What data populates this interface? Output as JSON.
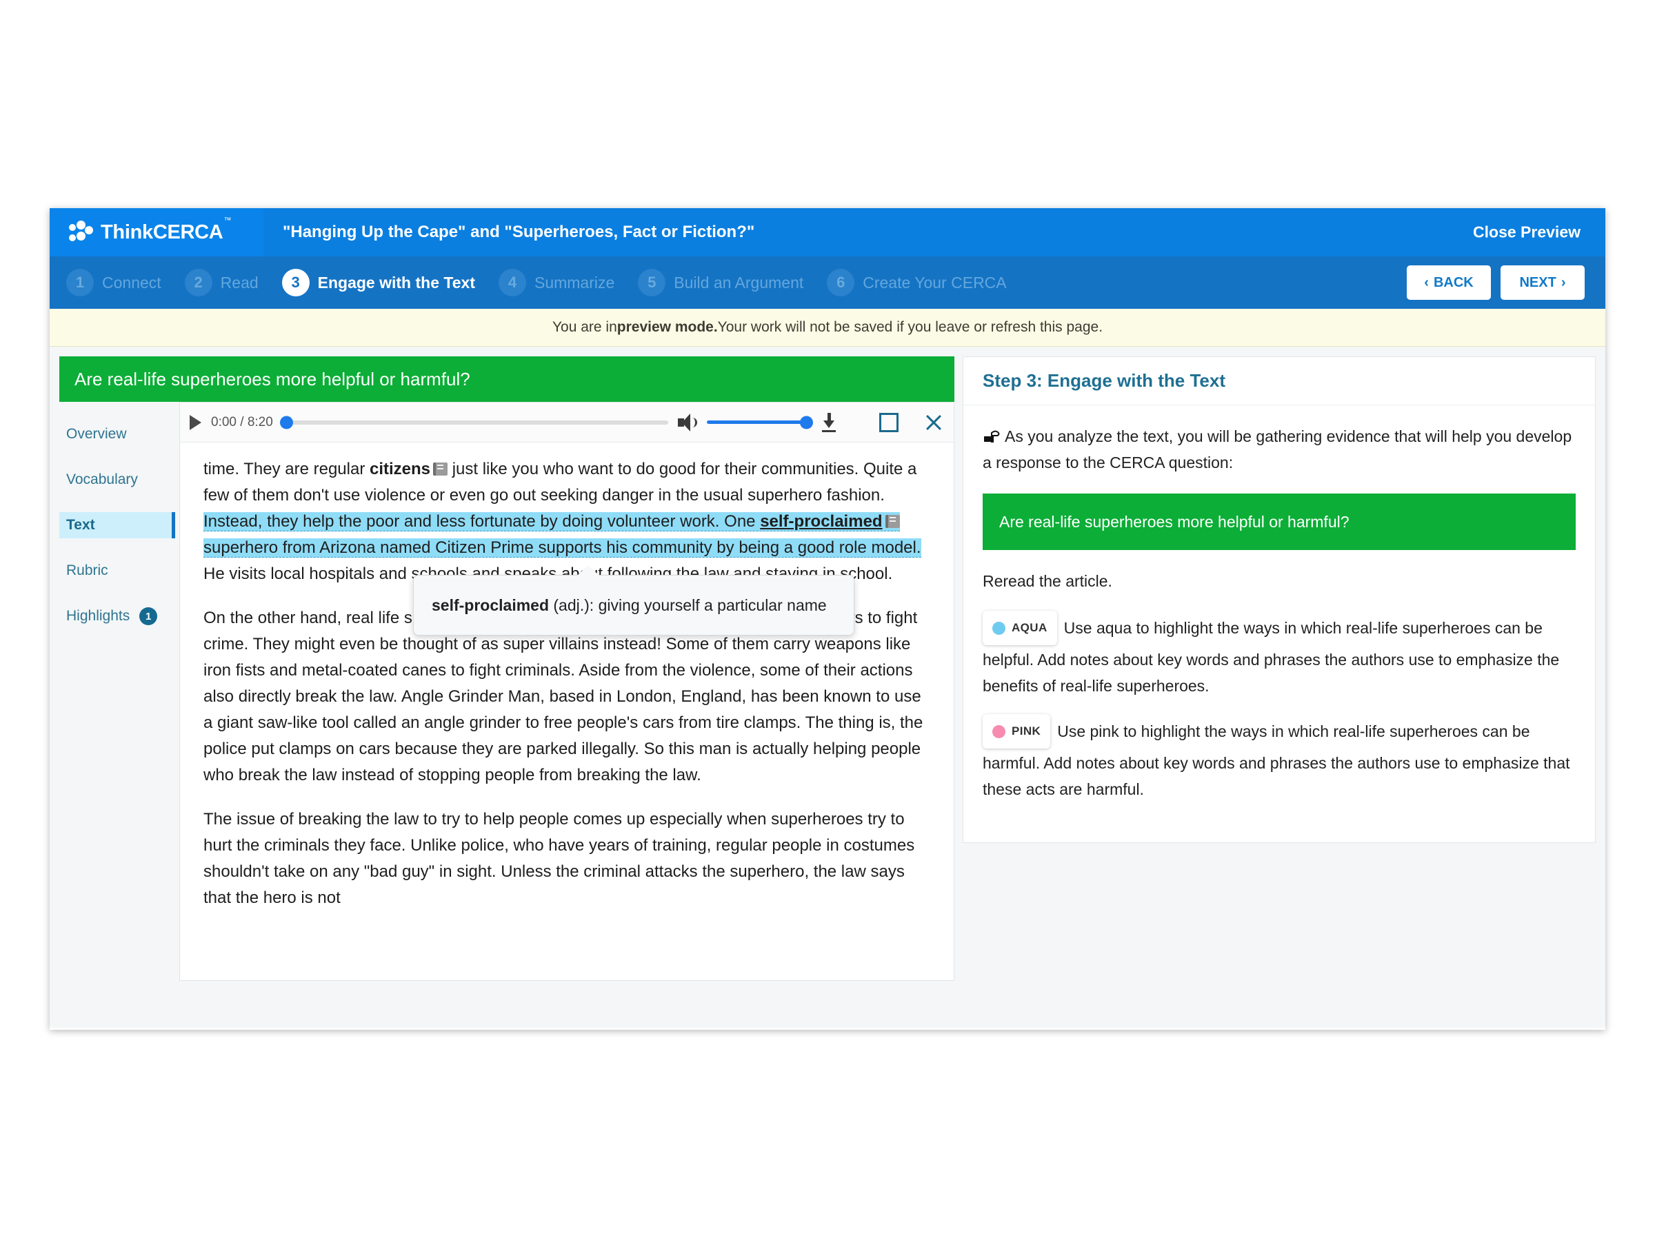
{
  "header": {
    "logo_text": "ThinkCERCA",
    "logo_tm": "™",
    "doc_title": "\"Hanging Up the Cape\" and \"Superheroes, Fact or Fiction?\"",
    "close_preview": "Close Preview"
  },
  "steps": [
    {
      "num": "1",
      "label": "Connect",
      "active": false
    },
    {
      "num": "2",
      "label": "Read",
      "active": false
    },
    {
      "num": "3",
      "label": "Engage with the Text",
      "active": true
    },
    {
      "num": "4",
      "label": "Summarize",
      "active": false
    },
    {
      "num": "5",
      "label": "Build an Argument",
      "active": false
    },
    {
      "num": "6",
      "label": "Create Your CERCA",
      "active": false
    }
  ],
  "nav": {
    "back": "BACK",
    "next": "NEXT",
    "back_chevron": "‹",
    "next_chevron": "›"
  },
  "preview_banner": {
    "lead": "You are in ",
    "strong": "preview mode.",
    "rest": " Your work will not be saved if you leave or refresh this page."
  },
  "left": {
    "green_banner": "Are real-life superheroes more helpful or harmful?",
    "sidenav": [
      {
        "label": "Overview",
        "active": false,
        "badge": ""
      },
      {
        "label": "Vocabulary",
        "active": false,
        "badge": ""
      },
      {
        "label": "Text",
        "active": true,
        "badge": ""
      },
      {
        "label": "Rubric",
        "active": false,
        "badge": ""
      },
      {
        "label": "Highlights",
        "active": false,
        "badge": "1"
      }
    ],
    "player": {
      "time": "0:00 / 8:20",
      "play_icon": "play-icon",
      "volume_icon": "volume-icon",
      "download_icon": "download-icon",
      "fullscreen_icon": "fullscreen-icon",
      "close_icon": "close-icon"
    },
    "article": {
      "p1_a": "time. They are regular ",
      "p1_word1": "citizens",
      "p1_b": " just like you who want to do good for their communities. Quite a few of them don't use violence or even go out seeking danger in the usual superhero fashion. ",
      "p1_hl_a": "Instead, they help the poor and less fortunate by doing volunteer work. One ",
      "p1_word2": "self-proclaimed",
      "p1_hl_b": " superhero from Arizona named Citizen Prime supports his community by being a good role model.",
      "p1_c": " He visits local hospitals and schools and speaks about following the law and staying in school.",
      "p2": "On the other hand, real life superheroes can be dangerous. Many of them use illegal ways to fight crime. They might even be thought of as super villains instead! Some of them carry weapons like iron fists and metal-coated canes to fight criminals. Aside from the violence, some of their actions also directly break the law. Angle Grinder Man, based in London, England, has been known to use a giant saw-like tool called an angle grinder to free people's cars from tire clamps. The thing is, the police put clamps on cars because they are parked illegally. So this man is actually helping people who break the law instead of stopping people from breaking the law.",
      "p3": "The issue of breaking the law to try to help people comes up especially when superheroes try to hurt the criminals they face. Unlike police, who have years of training, regular people in costumes shouldn't take on any \"bad guy\" in sight. Unless the criminal attacks the superhero, the law says that the hero is not"
    },
    "tooltip": {
      "term": "self-proclaimed",
      "definition": " (adj.): giving yourself a particular name"
    }
  },
  "right": {
    "card_title": "Step 3: Engage with the Text",
    "intro": "As you analyze the text, you will be gathering evidence that will help you develop a response to the CERCA question:",
    "green_question": "Are real-life superheroes more helpful or harmful?",
    "reread": "Reread the article.",
    "aqua": {
      "label": "AQUA",
      "color": "#6ecbf0",
      "text": "Use aqua to highlight the ways in which real-life superheroes can be helpful. Add notes about key words and phrases the authors use to emphasize the benefits of real-life superheroes."
    },
    "pink": {
      "label": "PINK",
      "color": "#f78bb0",
      "text": "Use pink to highlight the ways in which real-life superheroes can be harmful. Add notes about key words and phrases the authors use to emphasize that these acts are harmful."
    }
  },
  "colors": {
    "brand_blue": "#0b7fe0",
    "steps_blue": "#1573c4",
    "green": "#0cae37",
    "aqua_highlight": "#8fdcf7",
    "teal_text": "#2f7491"
  }
}
